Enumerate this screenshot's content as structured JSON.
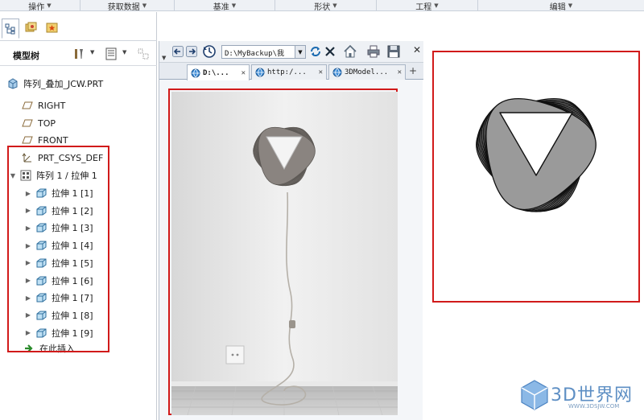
{
  "ribbon": {
    "groups": [
      "操作",
      "获取数据",
      "基准",
      "形状",
      "工程",
      "编辑"
    ]
  },
  "navigator": {
    "tabs": [
      "model-tree-tab",
      "folder-browser-tab",
      "favorites-tab"
    ],
    "title": "模型树",
    "tree": {
      "root": "阵列_叠加_JCW.PRT",
      "datums": [
        "RIGHT",
        "TOP",
        "FRONT",
        "PRT_CSYS_DEF"
      ],
      "pattern": "阵列 1 / 拉伸 1",
      "features": [
        "拉伸 1 [1]",
        "拉伸 1 [2]",
        "拉伸 1 [3]",
        "拉伸 1 [4]",
        "拉伸 1 [5]",
        "拉伸 1 [6]",
        "拉伸 1 [7]",
        "拉伸 1 [8]",
        "拉伸 1 [9]"
      ],
      "insert_here": "在此插入"
    }
  },
  "browser": {
    "address": "D:\\MyBackup\\我",
    "tabs": [
      {
        "label": "D:\\...",
        "active": true
      },
      {
        "label": "http:/...",
        "active": false
      },
      {
        "label": "3DModel...",
        "active": false
      }
    ]
  },
  "watermark": {
    "brand": "3D世界网",
    "url": "WWW.3DSJW.COM"
  },
  "colors": {
    "highlight_red": "#d11a1a",
    "lamp_gray": "#8a8480",
    "drawing_fill": "#9a9a9a"
  }
}
